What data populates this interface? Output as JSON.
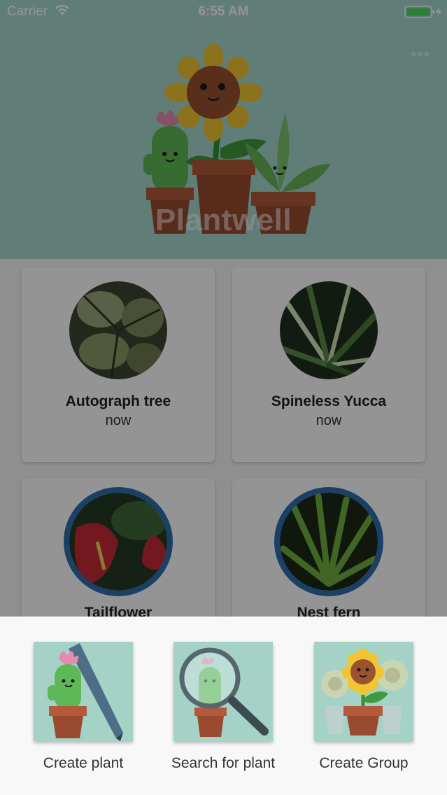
{
  "status_bar": {
    "carrier": "Carrier",
    "time": "6:55 AM"
  },
  "header": {
    "app_title": "Plantwell",
    "more_icon": "more-horizontal-icon"
  },
  "plants": [
    {
      "name": "Autograph tree",
      "subtitle": "now"
    },
    {
      "name": "Spineless Yucca",
      "subtitle": "now"
    },
    {
      "name": "Tailflower",
      "subtitle": ""
    },
    {
      "name": "Nest fern",
      "subtitle": ""
    }
  ],
  "action_sheet": {
    "actions": [
      {
        "label": "Create plant",
        "icon": "cactus-pen-icon"
      },
      {
        "label": "Search for plant",
        "icon": "magnifier-cactus-icon"
      },
      {
        "label": "Create Group",
        "icon": "sunflower-group-icon"
      }
    ]
  },
  "colors": {
    "header_bg": "#a8d8cd",
    "progress_ring": "#2f6fb0",
    "tile_bg": "#a4d2c7"
  }
}
